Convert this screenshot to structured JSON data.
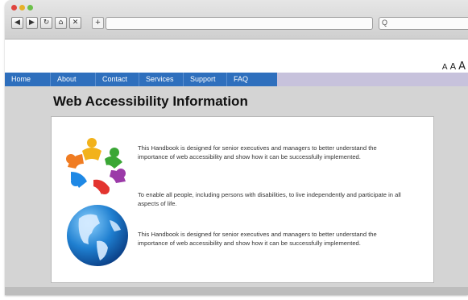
{
  "browser": {
    "nav_buttons": [
      {
        "name": "back-button",
        "icon": "back-arrow-icon",
        "glyph": "◀"
      },
      {
        "name": "forward-button",
        "icon": "forward-arrow-icon",
        "glyph": "▶"
      },
      {
        "name": "reload-button",
        "icon": "reload-icon",
        "glyph": "↻"
      },
      {
        "name": "home-button",
        "icon": "home-icon",
        "glyph": "⌂"
      },
      {
        "name": "close-tab-button",
        "icon": "close-icon",
        "glyph": "✕"
      }
    ],
    "new_tab_glyph": "+",
    "address_value": "",
    "search_value": "",
    "search_glyph": "Q"
  },
  "text_size": {
    "small": "A",
    "medium": "A",
    "large": "A"
  },
  "nav": {
    "items": [
      "Home",
      "About",
      "Contact",
      "Services",
      "Support",
      "FAQ"
    ]
  },
  "main": {
    "title": "Web Accessibility Information",
    "paragraphs": [
      "This Handbook is designed for senior executives and managers to better understand the importance of web accessibility and show how it can be successfully implemented.",
      "To enable all people, including persons with disabilities, to live independently and participate in all aspects of life.",
      "This Handbook is designed for senior executives and managers to better understand the importance of web accessibility and show how it can be successfully implemented."
    ]
  },
  "colors": {
    "nav_blue": "#2e6fbd",
    "nav_strip": "#c7c2dc",
    "page_bg": "#d4d4d4"
  }
}
